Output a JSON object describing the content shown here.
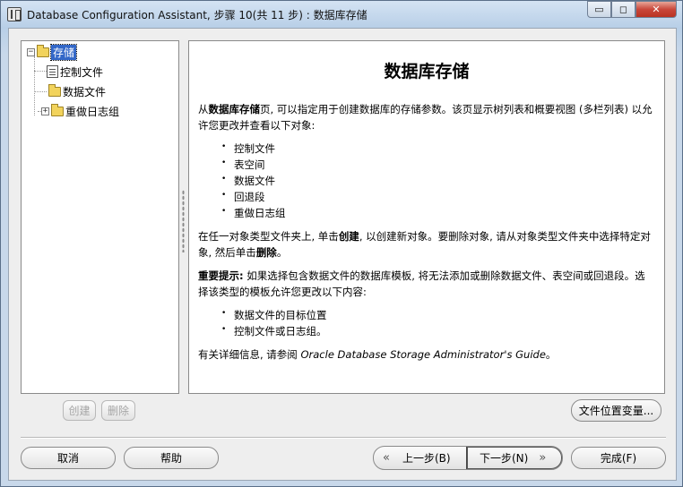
{
  "window": {
    "title": "Database Configuration Assistant, 步骤 10(共 11 步) : 数据库存储",
    "minimize_glyph": "▭",
    "maximize_glyph": "◻",
    "close_glyph": "✕"
  },
  "tree": {
    "root": {
      "label": "存储",
      "expander": "−"
    },
    "children": [
      {
        "label": "控制文件",
        "icon": "file-icon"
      },
      {
        "label": "数据文件",
        "icon": "folder-icon"
      },
      {
        "label": "重做日志组",
        "icon": "folder-icon",
        "expander": "+"
      }
    ]
  },
  "content": {
    "title": "数据库存储",
    "intro_prefix": "从",
    "intro_bold": "数据库存储",
    "intro_suffix": "页, 可以指定用于创建数据库的存储参数。该页显示树列表和概要视图 (多栏列表) 以允许您更改并查看以下对象:",
    "objects": [
      "控制文件",
      "表空间",
      "数据文件",
      "回退段",
      "重做日志组"
    ],
    "create_p1": "在任一对象类型文件夹上, 单击",
    "create_bold": "创建",
    "create_p2": ", 以创建新对象。要删除对象, 请从对象类型文件夹中选择特定对象, 然后单击",
    "delete_bold": "删除",
    "create_p3": "。",
    "important_bold": "重要提示:",
    "important_text": " 如果选择包含数据文件的数据库模板, 将无法添加或删除数据文件、表空间或回退段。选择该类型的模板允许您更改以下内容:",
    "template_items": [
      "数据文件的目标位置",
      "控制文件或日志组。"
    ],
    "more_info_prefix": "有关详细信息, 请参阅 ",
    "more_info_guide": "Oracle Database Storage Administrator's Guide",
    "more_info_suffix": "。"
  },
  "buttons": {
    "create": "创建",
    "delete": "删除",
    "file_location_vars": "文件位置变量...",
    "cancel": "取消",
    "help": "帮助",
    "back": "上一步(B)",
    "next": "下一步(N)",
    "finish": "完成(F)",
    "back_chevron": "«",
    "next_chevron": "»"
  }
}
